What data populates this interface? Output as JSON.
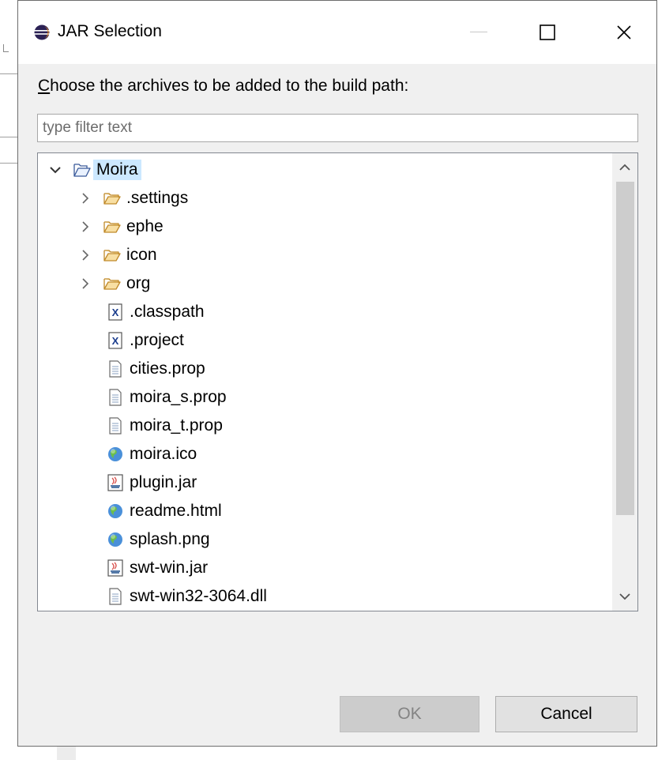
{
  "window": {
    "title": "JAR Selection",
    "minimize_label": "—",
    "close_label": "✕"
  },
  "dialog": {
    "prompt_mnemonic": "C",
    "prompt_rest": "hoose the archives to be added to the build path:",
    "filter_placeholder": "type filter text",
    "filter_value": ""
  },
  "tree": {
    "root": {
      "label": "Moira",
      "icon": "open-project-folder-icon",
      "expanded": true,
      "selected": true
    },
    "folders": [
      {
        "label": ".settings",
        "icon": "folder-icon"
      },
      {
        "label": "ephe",
        "icon": "folder-icon"
      },
      {
        "label": "icon",
        "icon": "folder-icon"
      },
      {
        "label": "org",
        "icon": "folder-icon"
      }
    ],
    "files": [
      {
        "label": ".classpath",
        "icon": "xml-file-icon"
      },
      {
        "label": ".project",
        "icon": "xml-file-icon"
      },
      {
        "label": "cities.prop",
        "icon": "text-file-icon"
      },
      {
        "label": "moira_s.prop",
        "icon": "text-file-icon"
      },
      {
        "label": "moira_t.prop",
        "icon": "text-file-icon"
      },
      {
        "label": "moira.ico",
        "icon": "globe-file-icon"
      },
      {
        "label": "plugin.jar",
        "icon": "jar-file-icon"
      },
      {
        "label": "readme.html",
        "icon": "globe-file-icon"
      },
      {
        "label": "splash.png",
        "icon": "globe-file-icon"
      },
      {
        "label": "swt-win.jar",
        "icon": "jar-file-icon"
      },
      {
        "label": "swt-win32-3064.dll",
        "icon": "text-file-icon"
      }
    ]
  },
  "buttons": {
    "ok_label": "OK",
    "cancel_label": "Cancel",
    "ok_enabled": false
  },
  "colors": {
    "selection": "#cce8ff",
    "dialog_bg": "#f0f0f0",
    "folder": "#dcb067",
    "eclipse_purple": "#2c2255"
  }
}
